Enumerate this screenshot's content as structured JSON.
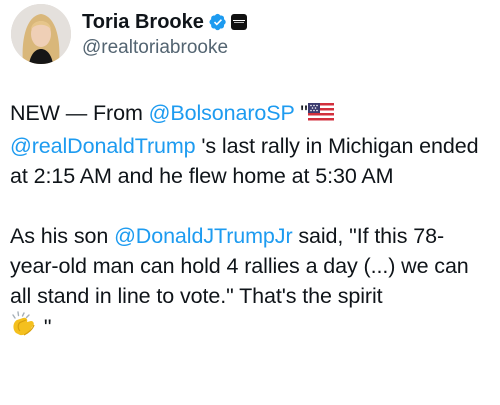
{
  "author": {
    "display_name": "Toria Brooke",
    "handle": "@realtoriabrooke"
  },
  "icons": {
    "avatar": "profile-photo",
    "verified": "blue-verified-check-icon",
    "affiliate": "affiliate-badge-icon",
    "flag": "us-flag-emoji",
    "clap": "clapping-hands-emoji"
  },
  "colors": {
    "mention": "#1d9bf0",
    "verified": "#1d9bf0",
    "text": "#0f1419",
    "handle": "#536471"
  },
  "tweet": {
    "p1_t1": "NEW — From ",
    "p1_m1": "@BolsonaroSP",
    "p1_t2": " \"",
    "p1_m2": "@realDonaldTrump",
    "p1_t3": " 's last rally in Michigan ended at 2:15 AM and he flew home at 5:30 AM",
    "p2_t1": "As his son ",
    "p2_m1": "@DonaldJTrumpJr",
    "p2_t2": " said, \"If this 78-year-old man can hold 4 rallies a day (...) we can all stand in line to vote.\" That's the spirit ",
    "p2_t3": " \""
  }
}
